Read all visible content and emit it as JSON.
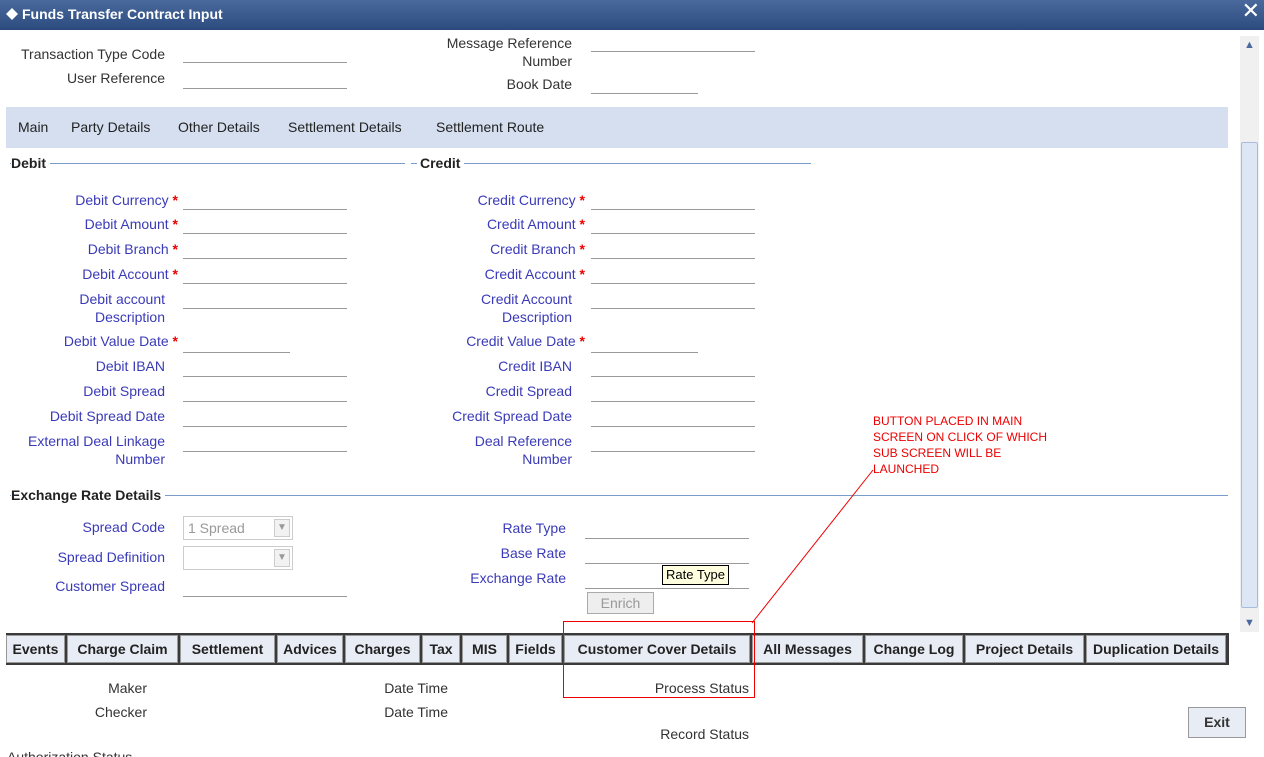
{
  "window": {
    "title": "Funds Transfer Contract Input",
    "close_symbol": "✕"
  },
  "header": {
    "transaction_type_code": "Transaction Type Code",
    "user_reference": "User Reference",
    "message_reference_1": "Message Reference",
    "message_reference_2": "Number",
    "book_date": "Book Date"
  },
  "tabs": [
    "Main",
    "Party Details",
    "Other Details",
    "Settlement Details",
    "Settlement Route"
  ],
  "debit": {
    "heading": "Debit",
    "currency": "Debit Currency",
    "amount": "Debit Amount",
    "branch": "Debit Branch",
    "account": "Debit Account",
    "account_desc_1": "Debit account",
    "account_desc_2": "Description",
    "value_date": "Debit Value Date",
    "iban": "Debit IBAN",
    "spread": "Debit Spread",
    "spread_date": "Debit Spread Date",
    "external_deal_1": "External Deal Linkage",
    "external_deal_2": "Number"
  },
  "credit": {
    "heading": "Credit",
    "currency": "Credit Currency",
    "amount": "Credit Amount",
    "branch": "Credit Branch",
    "account": "Credit Account",
    "account_desc_1": "Credit Account",
    "account_desc_2": "Description",
    "value_date": "Credit Value Date",
    "iban": "Credit IBAN",
    "spread": "Credit Spread",
    "spread_date": "Credit Spread Date",
    "deal_ref_1": "Deal Reference",
    "deal_ref_2": "Number"
  },
  "required_marker": "*",
  "exchange": {
    "heading": "Exchange Rate Details",
    "spread_code": "Spread Code",
    "spread_code_value": "1 Spread",
    "spread_definition": "Spread Definition",
    "customer_spread": "Customer Spread",
    "rate_type": "Rate Type",
    "base_rate": "Base Rate",
    "exchange_rate": "Exchange Rate",
    "enrich": "Enrich",
    "tooltip": "Rate Type"
  },
  "annotation": {
    "line1": "BUTTON PLACED IN MAIN",
    "line2": "SCREEN ON CLICK OF WHICH",
    "line3": "SUB SCREEN WILL BE",
    "line4": "LAUNCHED"
  },
  "bottom_buttons": [
    "Events",
    "Charge Claim",
    "Settlement",
    "Advices",
    "Charges",
    "Tax",
    "MIS",
    "Fields",
    "Customer Cover Details",
    "All Messages",
    "Change Log",
    "Project Details",
    "Duplication Details"
  ],
  "footer": {
    "maker": "Maker",
    "checker": "Checker",
    "date_time_1": "Date Time",
    "date_time_2": "Date Time",
    "process_status": "Process Status",
    "record_status": "Record Status",
    "authorization_status": "Authorization Status",
    "exit": "Exit"
  },
  "colors": {
    "titlebar": "#2c4a7e",
    "tab_strip": "#d5dff0",
    "label_blue": "#3a3ab8",
    "required": "#ee0000",
    "annotation": "#ee0000"
  }
}
